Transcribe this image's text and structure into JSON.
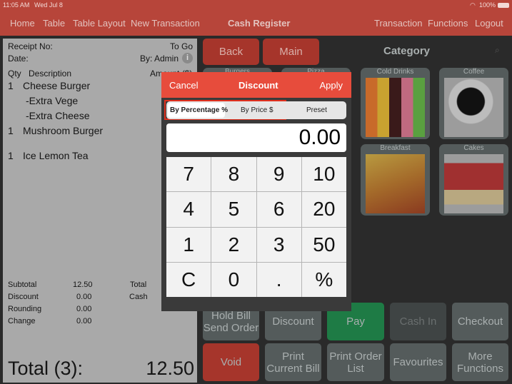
{
  "status": {
    "time": "11:05 AM",
    "date": "Wed Jul 8",
    "battery": "100%"
  },
  "nav": {
    "items": [
      "Home",
      "Table",
      "Table Layout",
      "New Transaction"
    ],
    "title": "Cash Register",
    "right": [
      "Transaction",
      "Functions",
      "Logout"
    ]
  },
  "receipt": {
    "receipt_no": "Receipt No:",
    "to_go": "To Go",
    "date": "Date:",
    "by": "By: Admin",
    "col_qty": "Qty",
    "col_desc": "Description",
    "col_amount": "Amount ($)",
    "items": [
      {
        "qty": "1",
        "desc": "Cheese Burger"
      },
      {
        "qty": "",
        "desc": "-Extra Vege"
      },
      {
        "qty": "",
        "desc": "-Extra Cheese"
      },
      {
        "qty": "1",
        "desc": "Mushroom Burger"
      },
      {
        "qty": "1",
        "desc": "Ice Lemon Tea"
      }
    ],
    "subtotal_label": "Subtotal",
    "subtotal": "12.50",
    "discount_label": "Discount",
    "discount": "0.00",
    "rounding_label": "Rounding",
    "rounding": "0.00",
    "change_label": "Change",
    "change": "0.00",
    "total_label": "Total",
    "cash_label": "Cash",
    "grand_label": "Total (3):",
    "grand_value": "12.50"
  },
  "buttons": {
    "back": "Back",
    "main": "Main",
    "category": "Category"
  },
  "categories": [
    "Burgers",
    "Pizza",
    "Cold Drinks",
    "Coffee",
    "Breakfast",
    "Cakes"
  ],
  "actions": {
    "hold": "Hold Bill Send Order",
    "discount": "Discount",
    "pay": "Pay",
    "cash_in": "Cash In",
    "checkout": "Checkout",
    "void": "Void",
    "print_bill": "Print Current Bill",
    "print_order": "Print Order List",
    "favourites": "Favourites",
    "more": "More Functions"
  },
  "popup": {
    "cancel": "Cancel",
    "title": "Discount",
    "apply": "Apply",
    "seg": [
      "By Percentage %",
      "By Price $",
      "Preset"
    ],
    "value": "0.00",
    "keys": [
      "7",
      "8",
      "9",
      "10",
      "4",
      "5",
      "6",
      "20",
      "1",
      "2",
      "3",
      "50",
      "C",
      "0",
      ".",
      "%"
    ]
  },
  "colors": {
    "accent": "#e74c3c",
    "pay": "#1e7b45",
    "void": "#a6352b"
  }
}
